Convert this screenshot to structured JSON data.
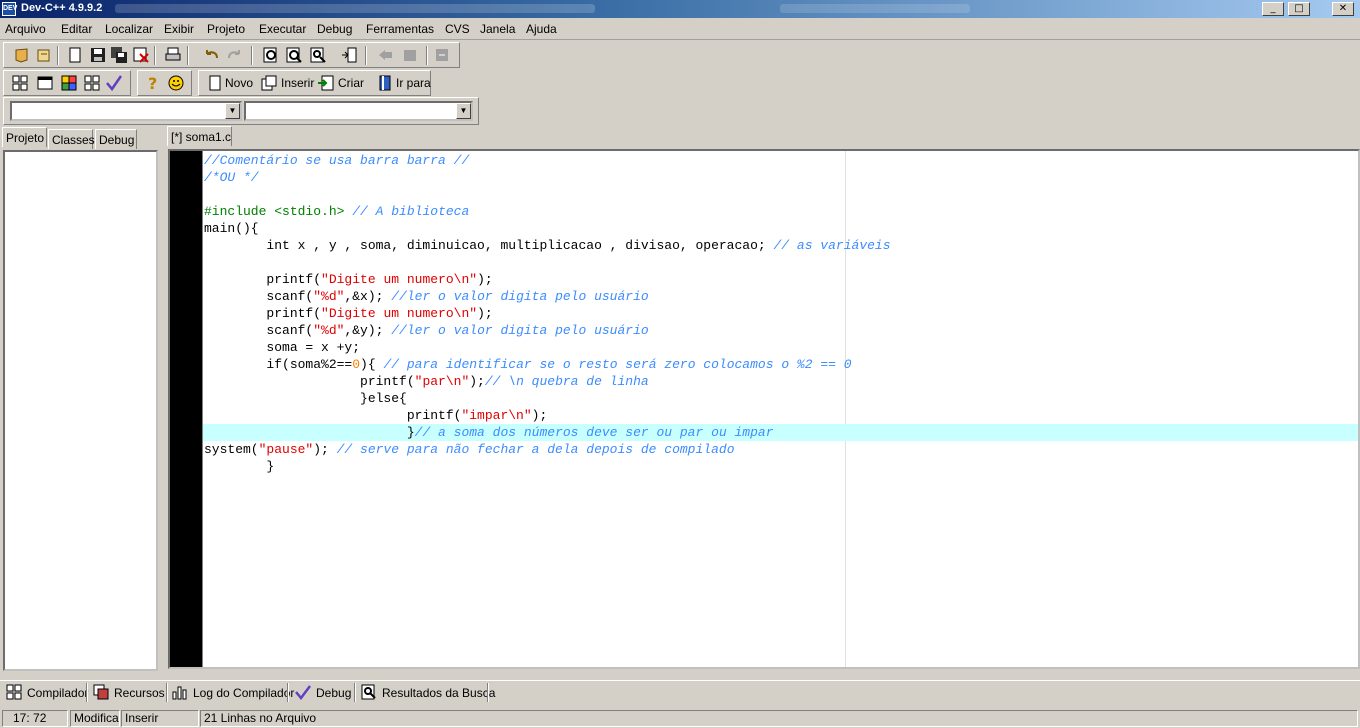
{
  "window": {
    "title": "Dev-C++ 4.9.9.2",
    "icon_label": "DEV",
    "minimize": "_",
    "maximize": "□",
    "close": "✕"
  },
  "menu": [
    "Arquivo",
    "Editar",
    "Localizar",
    "Exibir",
    "Projeto",
    "Executar",
    "Debug",
    "Ferramentas",
    "CVS",
    "Janela",
    "Ajuda"
  ],
  "toolbar2": {
    "novo": "Novo",
    "inserir": "Inserir",
    "criar": "Criar",
    "ir_para": "Ir para"
  },
  "left_tabs": [
    "Projeto",
    "Classes",
    "Debug"
  ],
  "editor_tab": "[*] soma1.c",
  "code_lines": [
    [
      [
        "c-com",
        "//Comentário se usa barra barra //"
      ]
    ],
    [
      [
        "c-com",
        "/*OU */"
      ]
    ],
    [],
    [
      [
        "c-pre",
        "#include <stdio.h>"
      ],
      [
        "c-plain",
        " "
      ],
      [
        "c-com",
        "// A biblioteca"
      ]
    ],
    [
      [
        "c-plain",
        "main(){"
      ]
    ],
    [
      [
        "c-plain",
        "        int x , y , soma, diminuicao, multiplicacao , divisao, operacao; "
      ],
      [
        "c-com",
        "// as variáveis"
      ]
    ],
    [],
    [
      [
        "c-plain",
        "        printf("
      ],
      [
        "c-str",
        "\"Digite um numero\\n\""
      ],
      [
        "c-plain",
        ");"
      ]
    ],
    [
      [
        "c-plain",
        "        scanf("
      ],
      [
        "c-str",
        "\"%d\""
      ],
      [
        "c-plain",
        ",&x); "
      ],
      [
        "c-com",
        "//ler o valor digita pelo usuário"
      ]
    ],
    [
      [
        "c-plain",
        "        printf("
      ],
      [
        "c-str",
        "\"Digite um numero\\n\""
      ],
      [
        "c-plain",
        ");"
      ]
    ],
    [
      [
        "c-plain",
        "        scanf("
      ],
      [
        "c-str",
        "\"%d\""
      ],
      [
        "c-plain",
        ",&y); "
      ],
      [
        "c-com",
        "//ler o valor digita pelo usuário"
      ]
    ],
    [
      [
        "c-plain",
        "        soma = x +y;"
      ]
    ],
    [
      [
        "c-plain",
        "        if(soma%2=="
      ],
      [
        "c-num",
        "0"
      ],
      [
        "c-plain",
        "){ "
      ],
      [
        "c-com",
        "// para identificar se o resto será zero colocamos o %2 == 0"
      ]
    ],
    [
      [
        "c-plain",
        "                    printf("
      ],
      [
        "c-str",
        "\"par\\n\""
      ],
      [
        "c-plain",
        ");"
      ],
      [
        "c-com",
        "// \\n quebra de linha"
      ]
    ],
    [
      [
        "c-plain",
        "                    }else{"
      ]
    ],
    [
      [
        "c-plain",
        "                          printf("
      ],
      [
        "c-str",
        "\"impar\\n\""
      ],
      [
        "c-plain",
        ");"
      ]
    ],
    [
      [
        "c-plain",
        "                          }"
      ],
      [
        "c-com",
        "// a soma dos números deve ser ou par ou impar"
      ]
    ],
    [
      [
        "c-plain",
        "system("
      ],
      [
        "c-str",
        "\"pause\""
      ],
      [
        "c-plain",
        "); "
      ],
      [
        "c-com",
        "// serve para não fechar a dela depois de compilado"
      ]
    ],
    [
      [
        "c-plain",
        "        }"
      ]
    ]
  ],
  "highlight_line_index": 16,
  "bottom_tabs": [
    "Compilador",
    "Recursos",
    "Log do Compilador",
    "Debug",
    "Resultados da Busca"
  ],
  "status": {
    "position": "17: 72",
    "modified": "Modificado",
    "mode": "Inserir",
    "lines": "21 Linhas no Arquivo"
  },
  "colors": {
    "comment": "#3c8cff",
    "string": "#e00000",
    "preprocessor": "#008000",
    "number": "#ff8000",
    "current_line": "#c8ffff",
    "gutter": "#000000"
  }
}
